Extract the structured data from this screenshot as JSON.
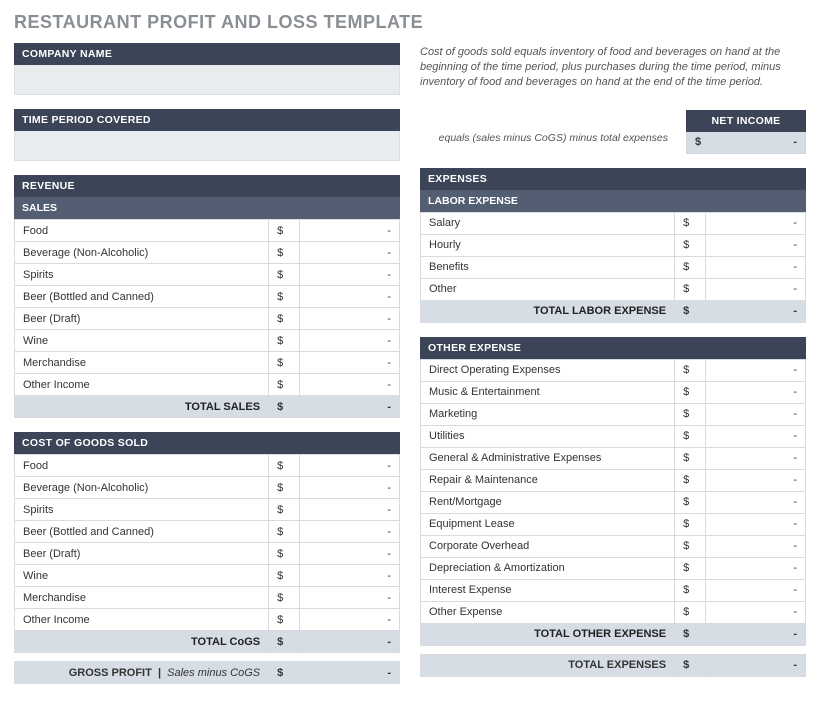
{
  "title": "RESTAURANT PROFIT AND LOSS TEMPLATE",
  "company": {
    "label": "COMPANY NAME"
  },
  "period": {
    "label": "TIME PERIOD COVERED"
  },
  "cogs_note": "Cost of goods sold equals inventory of food and beverages on hand at the beginning of the time period, plus purchases during the time period, minus inventory of food and beverages on hand at the end of the time period.",
  "netincome": {
    "label": "NET INCOME",
    "note": "equals (sales minus CoGS) minus total expenses",
    "currency": "$",
    "value": "-"
  },
  "revenue": {
    "header": "REVENUE",
    "sales_header": "SALES",
    "items": [
      {
        "label": "Food",
        "currency": "$",
        "value": "-"
      },
      {
        "label": "Beverage (Non-Alcoholic)",
        "currency": "$",
        "value": "-"
      },
      {
        "label": "Spirits",
        "currency": "$",
        "value": "-"
      },
      {
        "label": "Beer (Bottled and Canned)",
        "currency": "$",
        "value": "-"
      },
      {
        "label": "Beer (Draft)",
        "currency": "$",
        "value": "-"
      },
      {
        "label": "Wine",
        "currency": "$",
        "value": "-"
      },
      {
        "label": "Merchandise",
        "currency": "$",
        "value": "-"
      },
      {
        "label": "Other  Income",
        "currency": "$",
        "value": "-"
      }
    ],
    "total": {
      "label": "TOTAL SALES",
      "currency": "$",
      "value": "-"
    }
  },
  "cogs": {
    "header": "COST OF GOODS SOLD",
    "items": [
      {
        "label": "Food",
        "currency": "$",
        "value": "-"
      },
      {
        "label": "Beverage (Non-Alcoholic)",
        "currency": "$",
        "value": "-"
      },
      {
        "label": "Spirits",
        "currency": "$",
        "value": "-"
      },
      {
        "label": "Beer (Bottled and Canned)",
        "currency": "$",
        "value": "-"
      },
      {
        "label": "Beer (Draft)",
        "currency": "$",
        "value": "-"
      },
      {
        "label": "Wine",
        "currency": "$",
        "value": "-"
      },
      {
        "label": "Merchandise",
        "currency": "$",
        "value": "-"
      },
      {
        "label": "Other  Income",
        "currency": "$",
        "value": "-"
      }
    ],
    "total": {
      "label": "TOTAL CoGS",
      "currency": "$",
      "value": "-"
    }
  },
  "gross": {
    "label": "GROSS PROFIT",
    "sub": "Sales minus CoGS",
    "currency": "$",
    "value": "-"
  },
  "expenses": {
    "header": "EXPENSES",
    "labor_header": "LABOR EXPENSE",
    "labor": [
      {
        "label": "Salary",
        "currency": "$",
        "value": "-"
      },
      {
        "label": "Hourly",
        "currency": "$",
        "value": "-"
      },
      {
        "label": "Benefits",
        "currency": "$",
        "value": "-"
      },
      {
        "label": "Other",
        "currency": "$",
        "value": "-"
      }
    ],
    "labor_total": {
      "label": "TOTAL LABOR EXPENSE",
      "currency": "$",
      "value": "-"
    },
    "other_header": "OTHER EXPENSE",
    "other": [
      {
        "label": "Direct Operating Expenses",
        "currency": "$",
        "value": "-"
      },
      {
        "label": "Music & Entertainment",
        "currency": "$",
        "value": "-"
      },
      {
        "label": "Marketing",
        "currency": "$",
        "value": "-"
      },
      {
        "label": "Utilities",
        "currency": "$",
        "value": "-"
      },
      {
        "label": "General & Administrative Expenses",
        "currency": "$",
        "value": "-"
      },
      {
        "label": "Repair & Maintenance",
        "currency": "$",
        "value": "-"
      },
      {
        "label": "Rent/Mortgage",
        "currency": "$",
        "value": "-"
      },
      {
        "label": "Equipment Lease",
        "currency": "$",
        "value": "-"
      },
      {
        "label": "Corporate Overhead",
        "currency": "$",
        "value": "-"
      },
      {
        "label": "Depreciation & Amortization",
        "currency": "$",
        "value": "-"
      },
      {
        "label": "Interest Expense",
        "currency": "$",
        "value": "-"
      },
      {
        "label": "Other Expense",
        "currency": "$",
        "value": "-"
      }
    ],
    "other_total": {
      "label": "TOTAL OTHER EXPENSE",
      "currency": "$",
      "value": "-"
    },
    "total": {
      "label": "TOTAL EXPENSES",
      "currency": "$",
      "value": "-"
    }
  }
}
